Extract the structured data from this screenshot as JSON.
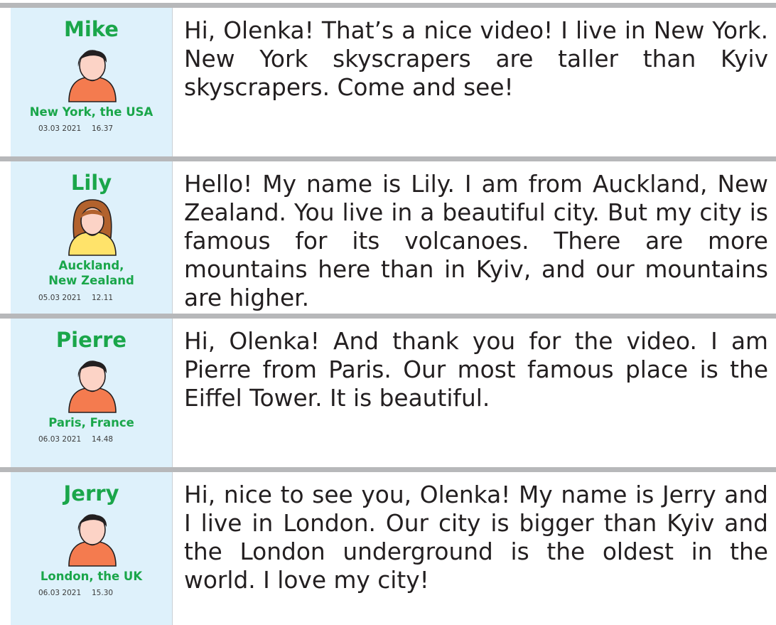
{
  "posts": [
    {
      "name": "Mike",
      "avatar": "boy-avatar-icon",
      "location_lines": [
        "New York, the USA"
      ],
      "date": "03.03 2021",
      "time": "16.37",
      "text": "Hi, Olenka! That’s a nice video! I live in New York. New York skyscrapers are taller than Kyiv skyscrapers. Come and see!"
    },
    {
      "name": "Lily",
      "avatar": "girl-avatar-icon",
      "location_lines": [
        "Auckland,",
        "New Zealand"
      ],
      "date": "05.03 2021",
      "time": "12.11",
      "text": "Hello! My name is Lily. I am from Auckland, New Zealand. You live in a beautiful city. But my city is famous for its volcanoes. There are more mountains here than in Kyiv, and our mountains are higher."
    },
    {
      "name": "Pierre",
      "avatar": "boy-avatar-icon",
      "location_lines": [
        "Paris, France"
      ],
      "date": "06.03 2021",
      "time": "14.48",
      "text": "Hi, Olenka! And thank you for the video. I am Pierre from Paris. Our most famous place is the Eiffel Tower. It is beautiful."
    },
    {
      "name": "Jerry",
      "avatar": "boy-avatar-icon",
      "location_lines": [
        "London, the UK"
      ],
      "date": "06.03 2021",
      "time": "15.30",
      "text": "Hi, nice to see you, Olenka! My name is Jerry and I live in London. Our city is bigger than Kyiv and the London underground is the oldest in the world. I love my city!"
    }
  ],
  "colors": {
    "name_green": "#1aa64a",
    "sidebar_blue": "#def1fb",
    "separator_gray": "#b7b8ba",
    "shirt_orange": "#f47b4f",
    "shirt_yellow": "#ffe36a",
    "skin": "#fcd3c6",
    "hair_dark": "#231f20",
    "hair_brown": "#b2622d"
  }
}
